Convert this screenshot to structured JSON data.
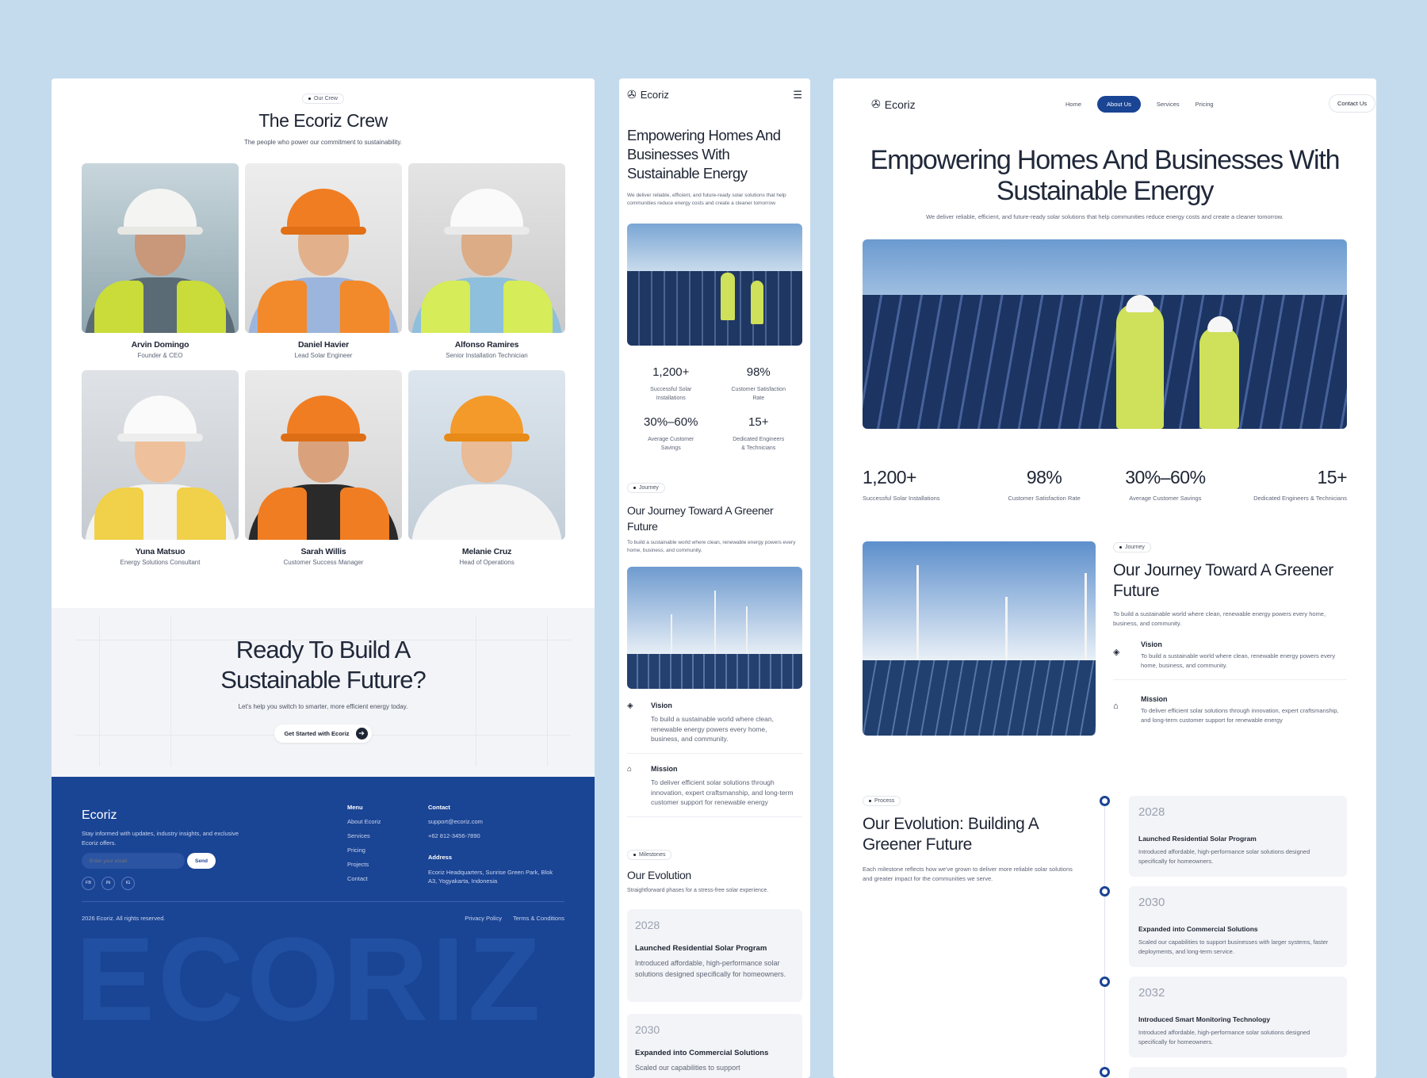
{
  "left": {
    "crew_pill": "Our Crew",
    "crew_title": "The Ecoriz Crew",
    "crew_subtitle": "The people who power our commitment to sustainability.",
    "members": [
      {
        "name": "Arvin Domingo",
        "role": "Founder & CEO"
      },
      {
        "name": "Daniel Havier",
        "role": "Lead Solar Engineer"
      },
      {
        "name": "Alfonso Ramires",
        "role": "Senior Installation Technician"
      },
      {
        "name": "Yuna Matsuo",
        "role": "Energy Solutions Consultant"
      },
      {
        "name": "Sarah Willis",
        "role": "Customer Success Manager"
      },
      {
        "name": "Melanie Cruz",
        "role": "Head of Operations"
      }
    ],
    "cta_title_1": "Ready To Build A",
    "cta_title_2": "Sustainable Future?",
    "cta_subtitle": "Let's help you switch to smarter, more efficient energy today.",
    "cta_button": "Get Started with Ecoriz",
    "cta_arrow": "➔",
    "footer": {
      "brand": "Ecoriz",
      "description": "Stay informed with updates, industry insights, and exclusive Ecoriz offers.",
      "email_placeholder": "Enter your email",
      "send": "Send",
      "social": [
        "FB",
        "IN",
        "IG"
      ],
      "menu_title": "Menu",
      "menu": [
        "About Ecoriz",
        "Services",
        "Pricing",
        "Projects",
        "Contact"
      ],
      "contact_title": "Contact",
      "email": "support@ecoriz.com",
      "phone": "+62 812-3456-7890",
      "address_title": "Address",
      "address": "Ecoriz Headquarters, Sunrise Green Park, Blok A3, Yogyakarta, Indonesia",
      "copyright": "2026 Ecoriz. All rights reserved.",
      "privacy": "Privacy Policy",
      "terms": "Terms & Conditions",
      "big_word": "ECORIZ"
    }
  },
  "brand": "Ecoriz",
  "hero": {
    "title": "Empowering Homes And Businesses With Sustainable Energy",
    "subtitle": "We deliver reliable, efficient, and future-ready solar solutions that help communities reduce energy costs and create a cleaner tomorrow."
  },
  "stats": [
    {
      "value": "1,200+",
      "label": "Successful Solar Installations"
    },
    {
      "value": "98%",
      "label": "Customer Satisfaction Rate"
    },
    {
      "value": "30%–60%",
      "label": "Average Customer Savings"
    },
    {
      "value": "15+",
      "label": "Dedicated Engineers & Technicians"
    }
  ],
  "journey": {
    "pill": "Journey",
    "title": "Our Journey Toward A Greener Future",
    "subtitle": "To build a sustainable world where clean, renewable energy powers every home, business, and community.",
    "vision_title": "Vision",
    "vision_text": "To build a sustainable world where clean, renewable energy powers every home, business, and community.",
    "mission_title": "Mission",
    "mission_text": "To deliver efficient solar solutions through innovation, expert craftsmanship, and long-term customer support for renewable energy",
    "vision_icon": "◈",
    "mission_icon": "⌂"
  },
  "mid": {
    "menu_icon": "☰",
    "milestones_pill": "Milestones",
    "evo_title": "Our Evolution",
    "evo_subtitle": "Straightforward phases for a stress-free solar experience."
  },
  "right": {
    "nav": [
      "Home",
      "About Us",
      "Services",
      "Pricing"
    ],
    "contact_button": "Contact Us",
    "process_pill": "Process",
    "evo_title": "Our Evolution: Building A Greener Future",
    "evo_subtitle": "Each milestone reflects how we've grown to deliver more reliable solar solutions and greater impact for the communities we serve."
  },
  "timeline": [
    {
      "year": "2028",
      "title": "Launched Residential Solar Program",
      "text": "Introduced affordable, high-performance solar solutions designed specifically for homeowners."
    },
    {
      "year": "2030",
      "title": "Expanded into Commercial Solutions",
      "text": "Scaled our capabilities to support businesses with larger systems, faster deployments, and long-term service."
    },
    {
      "year": "2032",
      "title": "Introduced Smart Monitoring Technology",
      "text": "Introduced affordable, high-performance solar solutions designed specifically for homeowners."
    }
  ],
  "mid_timeline_partial": "Scaled our capabilities to support",
  "colors": {
    "brand_blue": "#1a4494",
    "page_bg": "#c4dbee"
  }
}
